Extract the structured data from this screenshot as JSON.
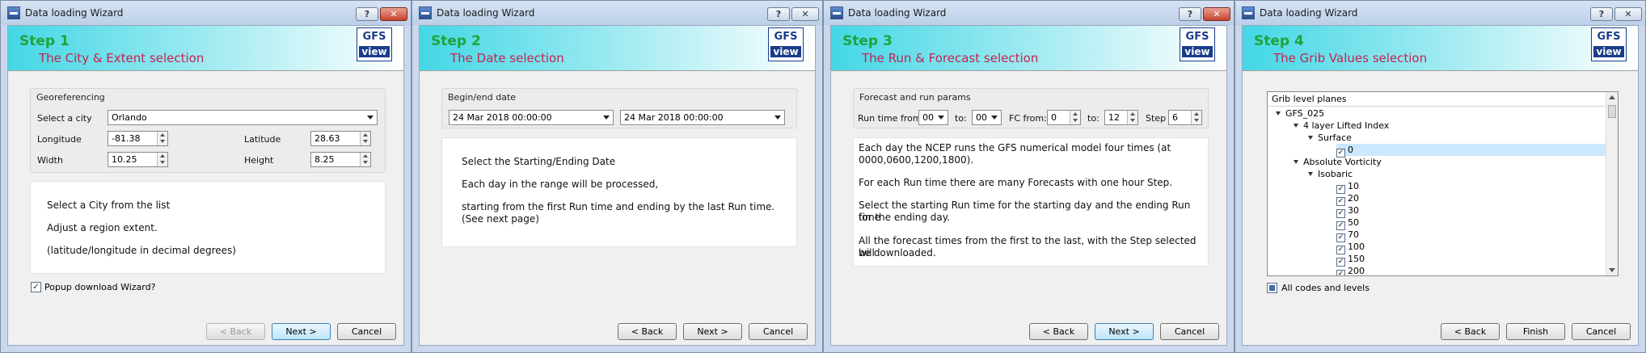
{
  "window_title": "Data loading Wizard",
  "title_buttons": {
    "help": "?",
    "close": "✕"
  },
  "logo": {
    "top": "GFS",
    "bottom": "view"
  },
  "buttons": {
    "back": "< Back",
    "next": "Next >",
    "cancel": "Cancel",
    "finish": "Finish"
  },
  "w1": {
    "step": "Step 1",
    "title": "The City & Extent selection",
    "group_title": "Georeferencing",
    "city_label": "Select a city",
    "city_value": "Orlando",
    "longitude_label": "Longitude",
    "longitude": "-81.38",
    "latitude_label": "Latitude",
    "latitude": "28.63",
    "width_label": "Width",
    "width": "10.25",
    "height_label": "Height",
    "height": "8.25",
    "info": [
      "Select a City from the list",
      "Adjust a region extent.",
      "(latitude/longitude in decimal degrees)"
    ],
    "popup_label": "Popup download Wizard?",
    "popup_checked": true
  },
  "w2": {
    "step": "Step 2",
    "title": "The Date selection",
    "group_title": "Begin/end date",
    "begin_date": "24 Mar 2018 00:00:00",
    "end_date": "24 Mar 2018 00:00:00",
    "info": [
      "Select the Starting/Ending Date",
      "Each day in the range will be processed,",
      "starting from the first Run time and ending by the last Run time.",
      "(See next page)"
    ]
  },
  "w3": {
    "step": "Step 3",
    "title": "The Run & Forecast selection",
    "group_title": "Forecast and run params",
    "run_from_label": "Run time from:",
    "run_from": "00",
    "run_to_label": "to:",
    "run_to": "00",
    "fc_from_label": "FC from:",
    "fc_from": "0",
    "fc_to_label": "to:",
    "fc_to": "12",
    "step_label": "Step",
    "step_value": "6",
    "info": [
      "Each day the NCEP runs the GFS numerical model four times (at",
      "0000,0600,1200,1800).",
      "For each Run time there are many Forecasts with one hour Step.",
      "Select the starting Run time for the starting day and the ending Run time",
      "for the ending day.",
      "All the forecast times from the first to the last, with the Step selected will",
      "be downloaded."
    ]
  },
  "w4": {
    "step": "Step 4",
    "title": "The Grib Values selection",
    "tree_header": "Grib level planes",
    "tree": [
      {
        "label": "GFS_025",
        "level": 0,
        "expand": true
      },
      {
        "label": "4 layer Lifted Index",
        "level": 1,
        "expand": true
      },
      {
        "label": "Surface",
        "level": 2,
        "expand": true
      },
      {
        "label": "0",
        "level": 3,
        "check": true,
        "selected": true
      },
      {
        "label": "Absolute Vorticity",
        "level": 1,
        "expand": true
      },
      {
        "label": "Isobaric",
        "level": 2,
        "expand": true
      },
      {
        "label": "10",
        "level": 3,
        "check": true
      },
      {
        "label": "20",
        "level": 3,
        "check": true
      },
      {
        "label": "30",
        "level": 3,
        "check": true
      },
      {
        "label": "50",
        "level": 3,
        "check": true
      },
      {
        "label": "70",
        "level": 3,
        "check": true
      },
      {
        "label": "100",
        "level": 3,
        "check": true
      },
      {
        "label": "150",
        "level": 3,
        "check": true
      },
      {
        "label": "200",
        "level": 3,
        "check": true
      }
    ],
    "all_codes_label": "All codes and levels"
  }
}
